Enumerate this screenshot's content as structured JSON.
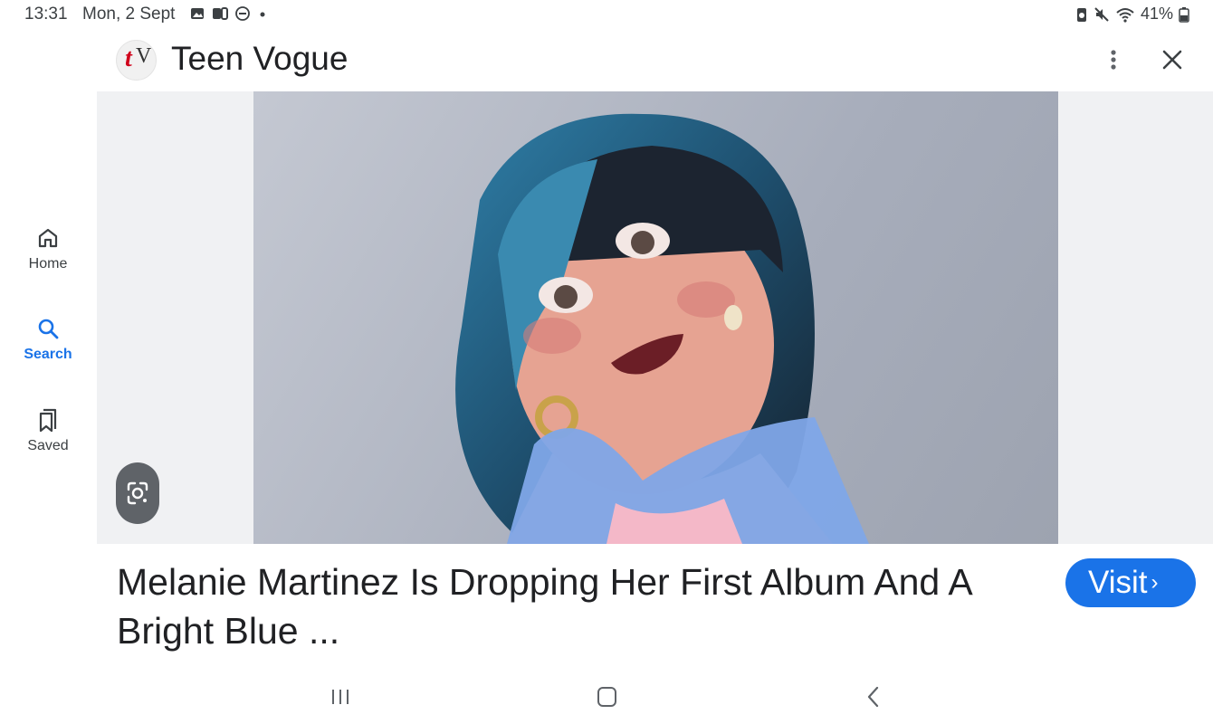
{
  "status_bar": {
    "time": "13:31",
    "date": "Mon, 2 Sept",
    "battery": "41%",
    "left_icons": [
      "gallery-icon",
      "app-icon",
      "dnd-icon",
      "dot-icon"
    ],
    "right_icons": [
      "battery-saver-icon",
      "mute-icon",
      "wifi-icon",
      "battery-icon"
    ]
  },
  "header": {
    "logo_text_t": "t",
    "logo_text_v": "V",
    "title": "Teen Vogue"
  },
  "rail": {
    "items": [
      {
        "label": "Home",
        "icon": "home-icon",
        "active": false
      },
      {
        "label": "Search",
        "icon": "search-icon",
        "active": true
      },
      {
        "label": "Saved",
        "icon": "bookmark-icon",
        "active": false
      }
    ]
  },
  "result": {
    "caption": "Melanie Martinez Is Dropping Her First Album And A Bright Blue ...",
    "visit_label": "Visit",
    "visit_chevron": "›"
  },
  "colors": {
    "accent": "#1a73e8",
    "lens_button": "#5f6368",
    "image_backdrop": "#f0f1f3"
  }
}
